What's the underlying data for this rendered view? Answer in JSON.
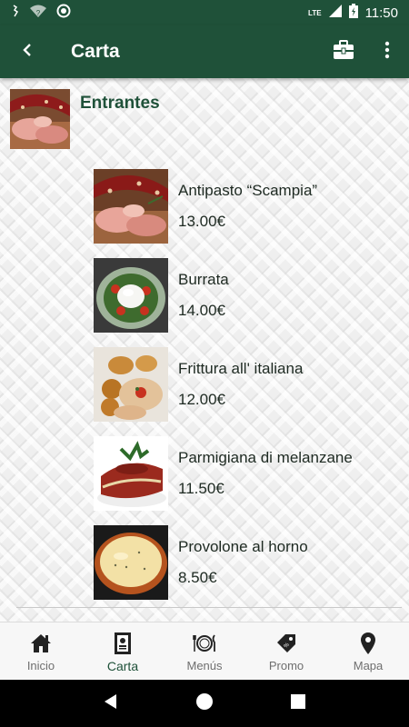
{
  "status_bar": {
    "time": "11:50",
    "network": "LTE",
    "icons": [
      "sim-icon",
      "wifi-unknown-icon",
      "circle-icon",
      "signal-icon",
      "battery-charging-icon"
    ]
  },
  "app_bar": {
    "title": "Carta",
    "icons": [
      "back-arrow-icon",
      "briefcase-icon",
      "more-vert-icon"
    ]
  },
  "category": {
    "title": "Entrantes",
    "items": [
      {
        "name": "Antipasto “Scampia”",
        "price": "13.00€"
      },
      {
        "name": "Burrata",
        "price": "14.00€"
      },
      {
        "name": "Frittura all' italiana",
        "price": "12.00€"
      },
      {
        "name": "Parmigiana di melanzane",
        "price": "11.50€"
      },
      {
        "name": "Provolone al horno",
        "price": "8.50€"
      }
    ]
  },
  "bottom_nav": {
    "items": [
      {
        "label": "Inicio",
        "icon": "home-icon",
        "active": false
      },
      {
        "label": "Carta",
        "icon": "menu-card-icon",
        "active": true
      },
      {
        "label": "Menús",
        "icon": "plate-cutlery-icon",
        "active": false
      },
      {
        "label": "Promo",
        "icon": "coupon-icon",
        "active": false
      },
      {
        "label": "Mapa",
        "icon": "map-pin-icon",
        "active": false
      }
    ]
  },
  "system_nav": {
    "icons": [
      "back-triangle-icon",
      "home-circle-icon",
      "recents-square-icon"
    ]
  },
  "colors": {
    "primary": "#1f5139",
    "text": "#1e2a22",
    "nav_inactive": "#6f6f6f"
  }
}
